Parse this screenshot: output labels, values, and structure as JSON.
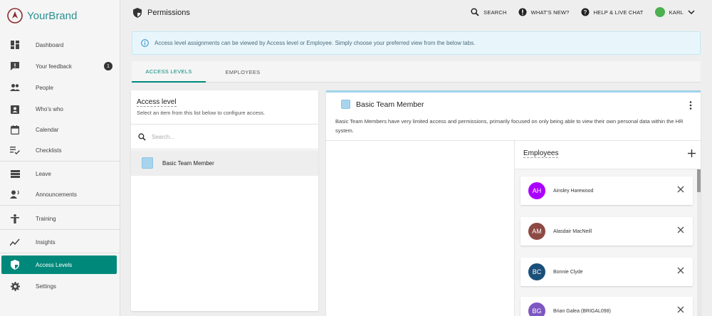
{
  "brand": {
    "name": "YourBrand",
    "accent": "#2a8f8f"
  },
  "sidebar": {
    "items": [
      {
        "label": "Dashboard",
        "icon": "dashboard-icon"
      },
      {
        "label": "Your feedback",
        "icon": "feedback-icon",
        "badge": "1"
      },
      {
        "label": "People",
        "icon": "people-icon"
      },
      {
        "label": "Who's who",
        "icon": "contact-card-icon"
      },
      {
        "label": "Calendar",
        "icon": "calendar-icon"
      },
      {
        "label": "Checklists",
        "icon": "checklist-icon"
      },
      {
        "label": "Leave",
        "icon": "leave-icon"
      },
      {
        "label": "Announcements",
        "icon": "announcements-icon"
      },
      {
        "label": "Training",
        "icon": "training-icon"
      },
      {
        "label": "Insights",
        "icon": "insights-icon"
      },
      {
        "label": "Access Levels",
        "icon": "shield-icon",
        "active": true
      },
      {
        "label": "Settings",
        "icon": "gear-icon"
      }
    ],
    "active_color": "#00897b"
  },
  "header": {
    "title": "Permissions",
    "search_label": "SEARCH",
    "whats_new_label": "WHAT'S NEW?",
    "help_label": "HELP & LIVE CHAT",
    "user_label": "KARL"
  },
  "banner": {
    "text": "Access level assignments can be viewed by Access level or Employee. Simply choose your preferred view from the below tabs."
  },
  "tabs": [
    {
      "label": "ACCESS LEVELS",
      "active": true
    },
    {
      "label": "EMPLOYEES",
      "active": false
    }
  ],
  "access_panel": {
    "title": "Access level",
    "subtitle": "Select an item from this list below to configure access.",
    "search_placeholder": "Search...",
    "items": [
      {
        "label": "Basic Team Member",
        "color": "#a9d4ee"
      }
    ]
  },
  "detail": {
    "title": "Basic Team Member",
    "color": "#a9d4ee",
    "description": "Basic Team Members have very limited access and permissions, primarily focused on only being able to view their own personal data within the HR system.",
    "employees_title": "Employees",
    "employees": [
      {
        "initials": "AH",
        "name": "Ainsley Harewood",
        "color": "#aa00ff"
      },
      {
        "initials": "AM",
        "name": "Alasdair MacNeill",
        "color": "#8d4a43"
      },
      {
        "initials": "BC",
        "name": "Bonnie Clyde",
        "color": "#1a4f7a"
      },
      {
        "initials": "BG",
        "name": "Brian Galea (BRIGAL098)",
        "color": "#7e57c2"
      }
    ]
  }
}
